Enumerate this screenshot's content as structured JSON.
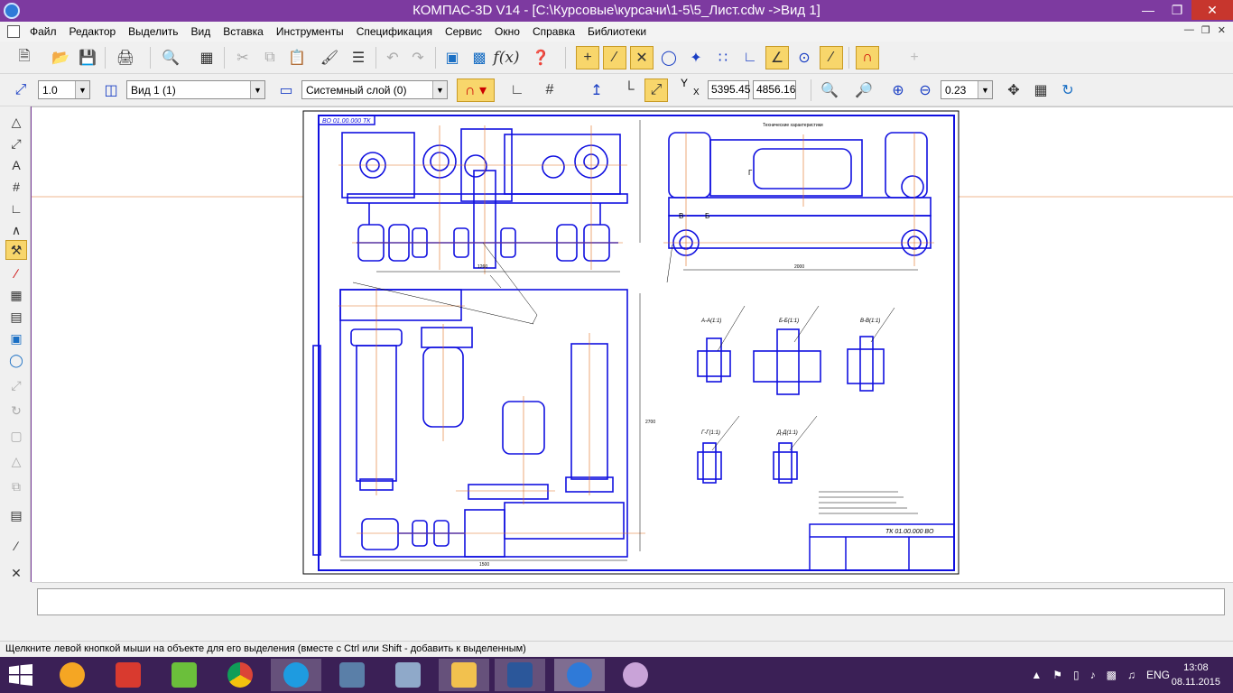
{
  "window": {
    "title": "КОМПАС-3D V14 - [C:\\Курсовые\\курсачи\\1-5\\5_Лист.cdw ->Вид 1]"
  },
  "menu": [
    "Файл",
    "Редактор",
    "Выделить",
    "Вид",
    "Вставка",
    "Инструменты",
    "Спецификация",
    "Сервис",
    "Окно",
    "Справка",
    "Библиотеки"
  ],
  "toolbar2": {
    "scale": "1.0",
    "view": "Вид 1 (1)",
    "layer": "Системный слой (0)",
    "coord_x": "5395.45",
    "coord_y": "4856.16",
    "zoom": "0.23",
    "y_label": "Y",
    "x_label": "X"
  },
  "drawing": {
    "stamp_code": "ТК 01.00.000 ВО",
    "corner_code": "ВО 01.00.000 ТК",
    "section_labels": [
      "А-А(1:1)",
      "Б-Б(1:1)",
      "В-В(1:1)",
      "Г-Г(1:1)",
      "Д-Д(1:1)"
    ],
    "view_letters": [
      "А",
      "Б",
      "В",
      "Г",
      "Д"
    ],
    "tech_title": "Технические характеристики",
    "dims": [
      "1260",
      "2000",
      "1500",
      "2700"
    ]
  },
  "status": {
    "hint": "Щелкните левой кнопкой мыши на объекте для его выделения (вместе с Ctrl или Shift - добавить к выделенным)"
  },
  "taskbar": {
    "lang": "ENG",
    "time": "13:08",
    "date": "08.11.2015"
  },
  "colors": {
    "titlebar": "#7d3aa0",
    "drawing_blue": "#1010e0",
    "axis_orange": "#e07020",
    "accent_yellow": "#f8d66b"
  }
}
